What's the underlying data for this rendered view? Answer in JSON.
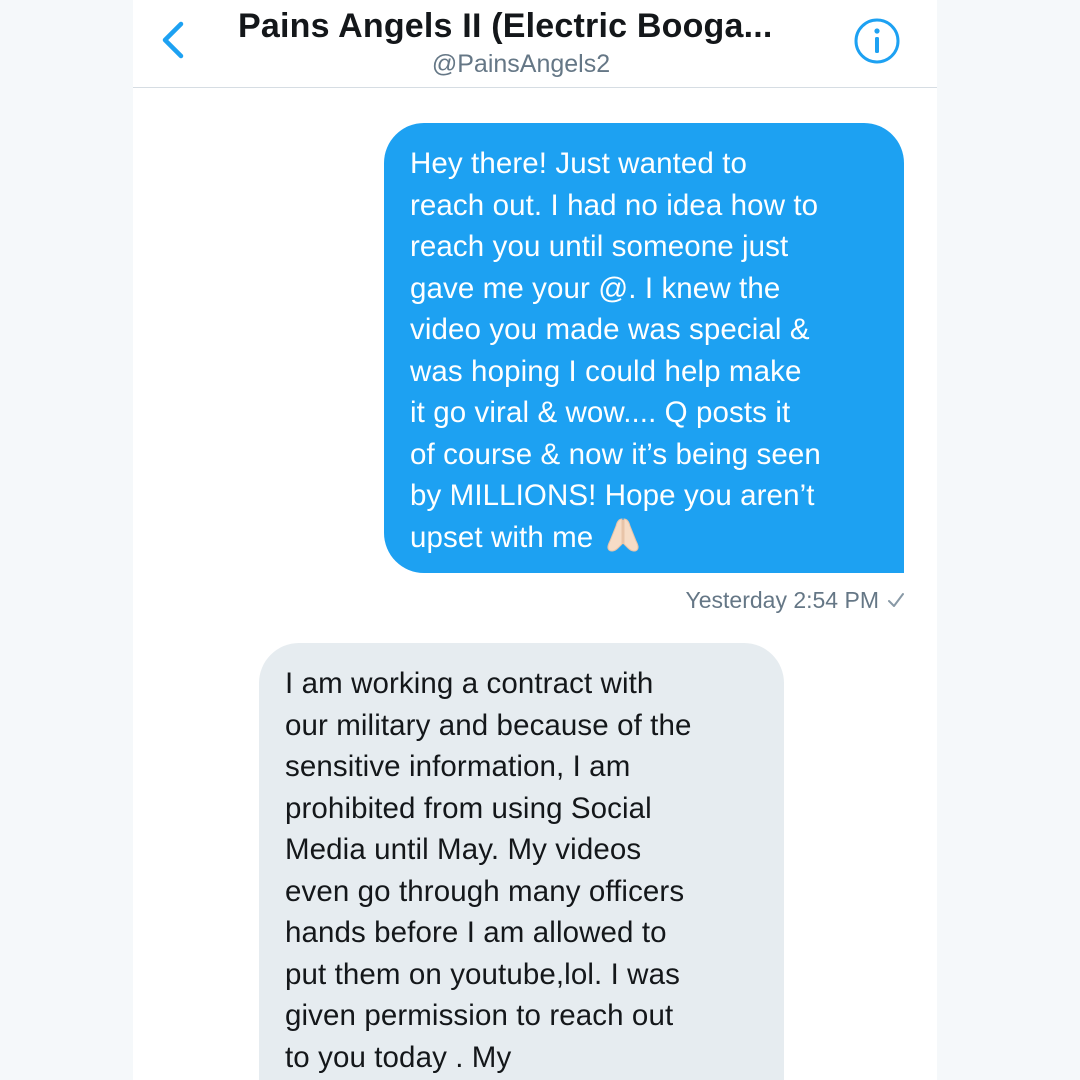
{
  "header": {
    "title": "Pains Angels II (Electric Booga...",
    "handle": "@PainsAngels2"
  },
  "icons": {
    "back": "chevron-left-icon",
    "info": "info-circle-icon",
    "emoji": "folded-hands-emoji-icon",
    "read_receipt": "checkmark-icon"
  },
  "colors": {
    "accent": "#1da1f2",
    "outgoing_bubble": "#1da1f2",
    "incoming_bubble": "#e6ecf0",
    "muted_text": "#657786"
  },
  "messages": {
    "outgoing": {
      "text": "Hey there! Just wanted to\nreach out. I had no idea how to\nreach you until someone just\ngave me your @. I knew the\nvideo you made was special &\nwas hoping I could help make\nit go viral & wow.... Q posts it\nof course & now it’s being seen\nby MILLIONS! Hope you aren’t\nupset with me",
      "timestamp": "Yesterday 2:54 PM"
    },
    "incoming": {
      "text": "I am working a contract with\nour military and because of the\nsensitive information, I am\nprohibited from using Social\nMedia until May.  My videos\neven go through many officers\nhands before I am allowed to\nput them on youtube,lol.  I was\ngiven permission to reach out\nto you today .            My"
    }
  }
}
